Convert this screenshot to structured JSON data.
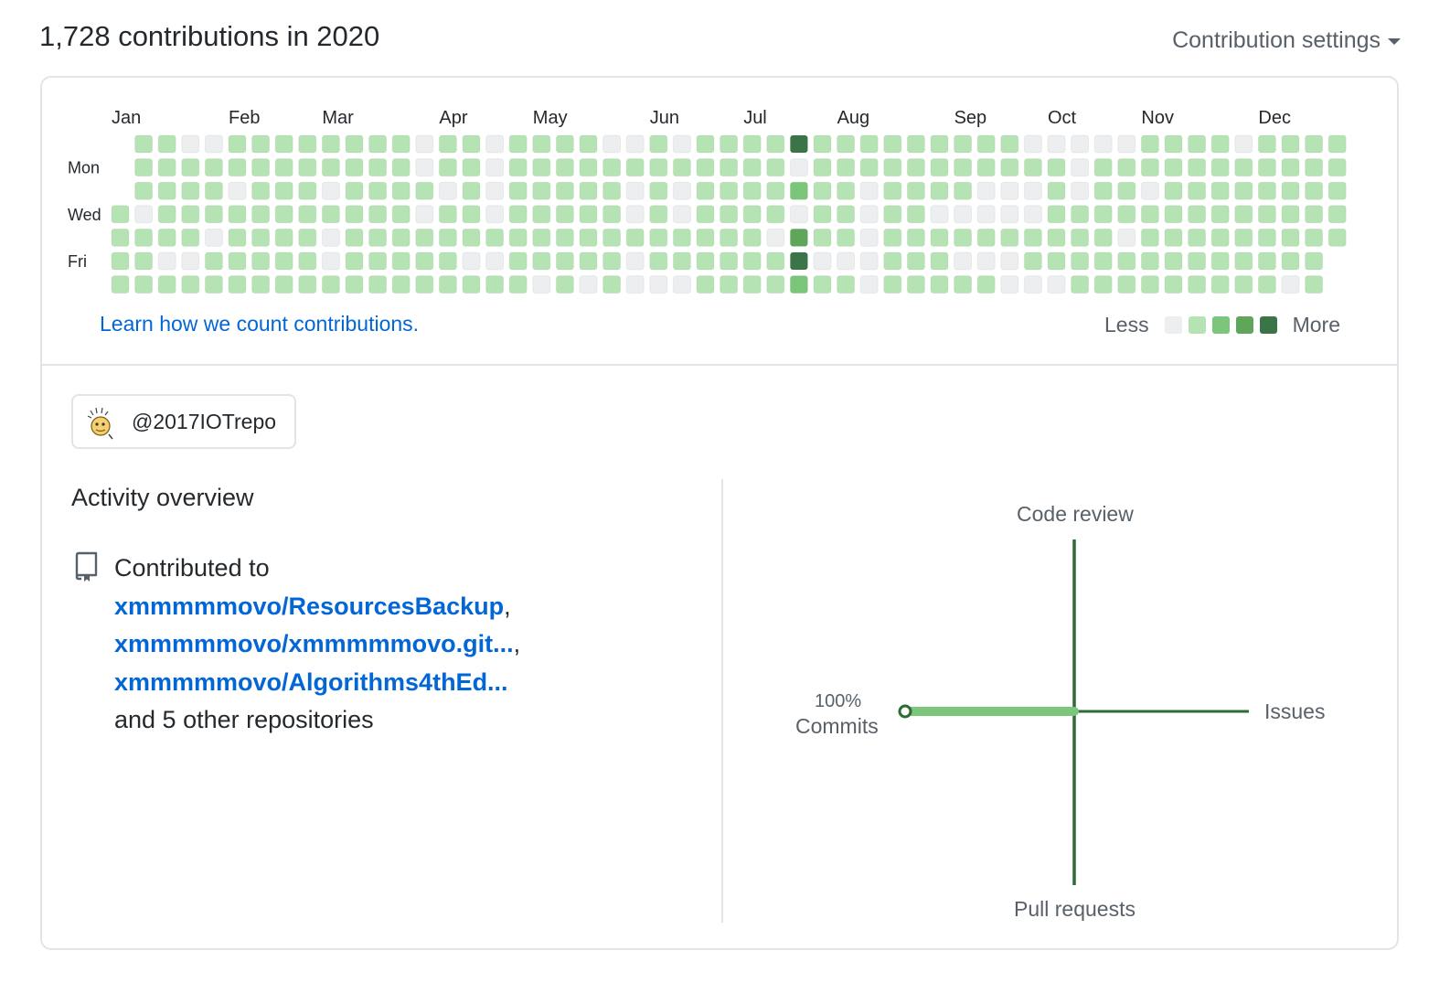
{
  "header": {
    "title": "1,728 contributions in 2020",
    "settings_label": "Contribution settings"
  },
  "calendar": {
    "months": [
      "Jan",
      "Feb",
      "Mar",
      "Apr",
      "May",
      "Jun",
      "Jul",
      "Aug",
      "Sep",
      "Oct",
      "Nov",
      "Dec"
    ],
    "month_start_weeks": [
      0,
      5,
      9,
      14,
      18,
      23,
      27,
      31,
      36,
      40,
      44,
      49
    ],
    "day_labels": [
      "Mon",
      "Wed",
      "Fri"
    ],
    "day_label_rows": [
      1,
      3,
      5
    ],
    "colors": [
      "#ebedf0",
      "#9be9a8",
      "#40c463",
      "#30a14e",
      "#216e39"
    ],
    "display_colors": [
      "#eceef0",
      "#b6e3b3",
      "#7bc67a",
      "#5fa55a",
      "#3b7446"
    ],
    "weeks": [
      "0001111",
      "1110111",
      "1111101",
      "0111101",
      "0111011",
      "1101111",
      "1111111",
      "1111111",
      "1111111",
      "1101001",
      "1111111",
      "1111111",
      "1111111",
      "0010111",
      "1101111",
      "1111101",
      "0000101",
      "1111111",
      "1111110",
      "1111111",
      "1111110",
      "0111111",
      "0100100",
      "1111110",
      "0100110",
      "1111111",
      "1111111",
      "1111111",
      "1111011",
      "4020342",
      "1111101",
      "1111101",
      "1100000",
      "1111111",
      "1111111",
      "1110111",
      "1110101",
      "1100101",
      "1100100",
      "0100110",
      "0111110",
      "0001111",
      "0111111",
      "0111011",
      "1101111",
      "1111111",
      "1111111",
      "1111111",
      "0111111",
      "1111111",
      "1111110",
      "1111111",
      "1111100"
    ],
    "first_week_start_row": 3,
    "learn_link": "Learn how we count contributions.",
    "legend_less": "Less",
    "legend_more": "More"
  },
  "org": {
    "name": "@2017IOTrepo"
  },
  "activity": {
    "title": "Activity overview",
    "contributed_to": "Contributed to",
    "repos": [
      "xmmmmmovo/ResourcesBackup",
      "xmmmmmovo/xmmmmmovo.git...",
      "xmmmmmovo/Algorithms4thEd..."
    ],
    "other_repos": "and 5 other repositories"
  },
  "radar": {
    "labels": {
      "code_review": "Code review",
      "issues": "Issues",
      "pull_requests": "Pull requests",
      "commits": "Commits",
      "commits_pct": "100%"
    },
    "values": {
      "commits": 100,
      "code_review": 0,
      "issues": 0,
      "pull_requests": 0
    },
    "colors": {
      "axis": "#2f6b35",
      "fill": "#7bc67a"
    }
  }
}
